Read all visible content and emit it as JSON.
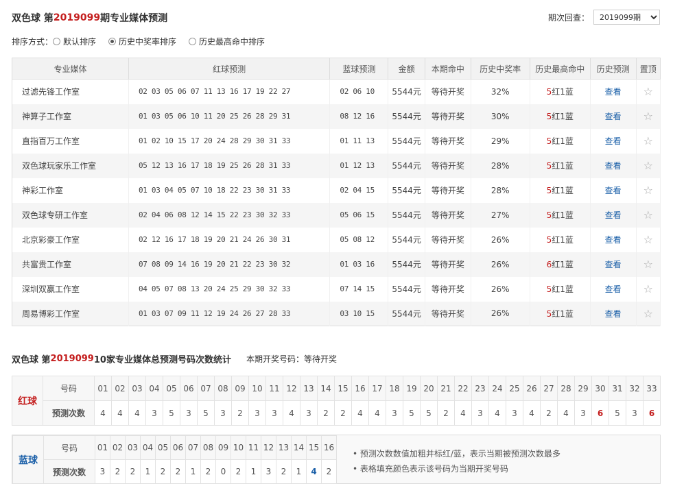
{
  "header": {
    "prefix": "双色球 第",
    "issue": "2019099",
    "suffix": "期专业媒体预测"
  },
  "period": {
    "label": "期次回查：",
    "selected": "2019099期"
  },
  "sort": {
    "label": "排序方式：",
    "options": [
      {
        "label": "默认排序",
        "checked": false
      },
      {
        "label": "历史中奖率排序",
        "checked": true
      },
      {
        "label": "历史最高命中排序",
        "checked": false
      }
    ]
  },
  "table": {
    "headers": [
      "专业媒体",
      "红球预测",
      "蓝球预测",
      "金额",
      "本期命中",
      "历史中奖率",
      "历史最高命中",
      "历史预测",
      "置顶"
    ],
    "rows": [
      {
        "media": "过滤先锋工作室",
        "red": "02 03 05 06 07 11 13 16 17 19 22 27",
        "blue": "02 06 10",
        "amount": "5544元",
        "hit": "等待开奖",
        "rate": "32%",
        "max_n": "5",
        "max_rest": "红1蓝",
        "view": "查看"
      },
      {
        "media": "神算子工作室",
        "red": "01 03 05 06 10 11 20 25 26 28 29 31",
        "blue": "08 12 16",
        "amount": "5544元",
        "hit": "等待开奖",
        "rate": "30%",
        "max_n": "5",
        "max_rest": "红1蓝",
        "view": "查看"
      },
      {
        "media": "直指百万工作室",
        "red": "01 02 10 15 17 20 24 28 29 30 31 33",
        "blue": "01 11 13",
        "amount": "5544元",
        "hit": "等待开奖",
        "rate": "29%",
        "max_n": "5",
        "max_rest": "红1蓝",
        "view": "查看"
      },
      {
        "media": "双色球玩家乐工作室",
        "red": "05 12 13 16 17 18 19 25 26 28 31 33",
        "blue": "01 12 13",
        "amount": "5544元",
        "hit": "等待开奖",
        "rate": "28%",
        "max_n": "5",
        "max_rest": "红1蓝",
        "view": "查看"
      },
      {
        "media": "神彩工作室",
        "red": "01 03 04 05 07 10 18 22 23 30 31 33",
        "blue": "02 04 15",
        "amount": "5544元",
        "hit": "等待开奖",
        "rate": "28%",
        "max_n": "5",
        "max_rest": "红1蓝",
        "view": "查看"
      },
      {
        "media": "双色球专研工作室",
        "red": "02 04 06 08 12 14 15 22 23 30 32 33",
        "blue": "05 06 15",
        "amount": "5544元",
        "hit": "等待开奖",
        "rate": "27%",
        "max_n": "5",
        "max_rest": "红1蓝",
        "view": "查看"
      },
      {
        "media": "北京彩豪工作室",
        "red": "02 12 16 17 18 19 20 21 24 26 30 31",
        "blue": "05 08 12",
        "amount": "5544元",
        "hit": "等待开奖",
        "rate": "26%",
        "max_n": "5",
        "max_rest": "红1蓝",
        "view": "查看"
      },
      {
        "media": "共富贵工作室",
        "red": "07 08 09 14 16 19 20 21 22 23 30 32",
        "blue": "01 03 16",
        "amount": "5544元",
        "hit": "等待开奖",
        "rate": "26%",
        "max_n": "6",
        "max_rest": "红1蓝",
        "view": "查看"
      },
      {
        "media": "深圳双赢工作室",
        "red": "04 05 07 08 13 20 24 25 29 30 32 33",
        "blue": "07 14 15",
        "amount": "5544元",
        "hit": "等待开奖",
        "rate": "26%",
        "max_n": "5",
        "max_rest": "红1蓝",
        "view": "查看"
      },
      {
        "media": "周易博彩工作室",
        "red": "01 03 07 09 11 12 19 24 26 27 28 33",
        "blue": "03 10 15",
        "amount": "5544元",
        "hit": "等待开奖",
        "rate": "26%",
        "max_n": "5",
        "max_rest": "红1蓝",
        "view": "查看"
      }
    ]
  },
  "stats": {
    "prefix": "双色球 第",
    "issue": "2019099",
    "suffix": " 10家专业媒体总预测号码次数统计",
    "draw_label": "本期开奖号码：",
    "draw_value": "等待开奖"
  },
  "red_stats": {
    "label": "红球",
    "row1_label": "号码",
    "row2_label": "预测次数",
    "numbers": [
      "01",
      "02",
      "03",
      "04",
      "05",
      "06",
      "07",
      "08",
      "09",
      "10",
      "11",
      "12",
      "13",
      "14",
      "15",
      "16",
      "17",
      "18",
      "19",
      "20",
      "21",
      "22",
      "23",
      "24",
      "25",
      "26",
      "27",
      "28",
      "29",
      "30",
      "31",
      "32",
      "33"
    ],
    "counts": [
      "4",
      "4",
      "4",
      "3",
      "5",
      "3",
      "5",
      "3",
      "2",
      "3",
      "3",
      "4",
      "3",
      "2",
      "2",
      "4",
      "4",
      "3",
      "5",
      "5",
      "2",
      "4",
      "3",
      "4",
      "3",
      "4",
      "2",
      "4",
      "3",
      "6",
      "5",
      "3",
      "6"
    ],
    "hot": [
      29,
      32
    ]
  },
  "blue_stats": {
    "label": "蓝球",
    "row1_label": "号码",
    "row2_label": "预测次数",
    "numbers": [
      "01",
      "02",
      "03",
      "04",
      "05",
      "06",
      "07",
      "08",
      "09",
      "10",
      "11",
      "12",
      "13",
      "14",
      "15",
      "16"
    ],
    "counts": [
      "3",
      "2",
      "2",
      "1",
      "2",
      "2",
      "1",
      "2",
      "0",
      "2",
      "1",
      "3",
      "2",
      "1",
      "4",
      "2"
    ],
    "hot": [
      14
    ]
  },
  "notes": [
    "• 预测次数数值加粗并标红/蓝，表示当期被预测次数最多",
    "• 表格填充颜色表示该号码为当期开奖号码"
  ]
}
